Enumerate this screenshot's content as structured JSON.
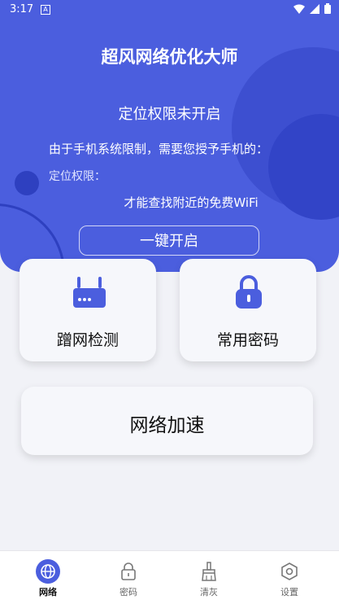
{
  "status": {
    "time": "3:17"
  },
  "header": {
    "title": "超风网络优化大师"
  },
  "permission": {
    "title": "定位权限未开启",
    "description": "由于手机系统限制，需要您授予手机的：",
    "label": "定位权限：",
    "note": "才能查找附近的免费WiFi",
    "button_label": "一键开启"
  },
  "cards": {
    "network_check": "蹭网检测",
    "common_password": "常用密码",
    "network_speedup": "网络加速"
  },
  "nav": {
    "items": [
      {
        "label": "网络",
        "icon": "globe-icon"
      },
      {
        "label": "密码",
        "icon": "lock-icon"
      },
      {
        "label": "清灰",
        "icon": "brush-icon"
      },
      {
        "label": "设置",
        "icon": "hexagon-settings-icon"
      }
    ]
  },
  "colors": {
    "accent": "#4b5ede",
    "background": "#f1f2f7"
  }
}
